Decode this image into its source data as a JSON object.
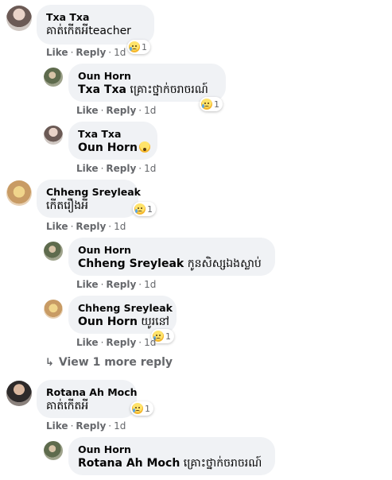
{
  "comments": [
    {
      "author": "Txa Txa",
      "text": "គាត់កើតអីteacher",
      "reaction_count": "1",
      "time": "1d"
    },
    {
      "author": "Oun Horn",
      "tag": "Txa Txa",
      "text": "គ្រោះថ្នាក់ចរាចរណ៍",
      "reaction_count": "1",
      "time": "1d"
    },
    {
      "author": "Txa Txa",
      "tag": "Oun Horn",
      "text": "",
      "time": "1d"
    },
    {
      "author": "Chheng Sreyleak",
      "text": "កើតរឿងអី",
      "reaction_count": "1",
      "time": "1d"
    },
    {
      "author": "Oun Horn",
      "tag": "Chheng Sreyleak",
      "text": "កូនសិស្សឯងស្លាប់",
      "time": "1d"
    },
    {
      "author": "Chheng Sreyleak",
      "tag": "Oun Horn",
      "text": "យូរនៅ",
      "reaction_count": "1",
      "time": "1d"
    },
    {
      "author": "Rotana Ah Moch",
      "text": "គាត់កើតអី",
      "reaction_count": "1",
      "time": "1d"
    },
    {
      "author": "Oun Horn",
      "tag": "Rotana Ah Moch",
      "text": "គ្រោះថ្នាក់ចរាចរណ៍"
    }
  ],
  "actions": {
    "like": "Like",
    "reply": "Reply",
    "dot": "·"
  },
  "view_more": {
    "arrow": "↳",
    "label": "View 1 more reply"
  },
  "reaction_icon": "sad-crying-face",
  "inline_emoji_icon": "astonished-face"
}
